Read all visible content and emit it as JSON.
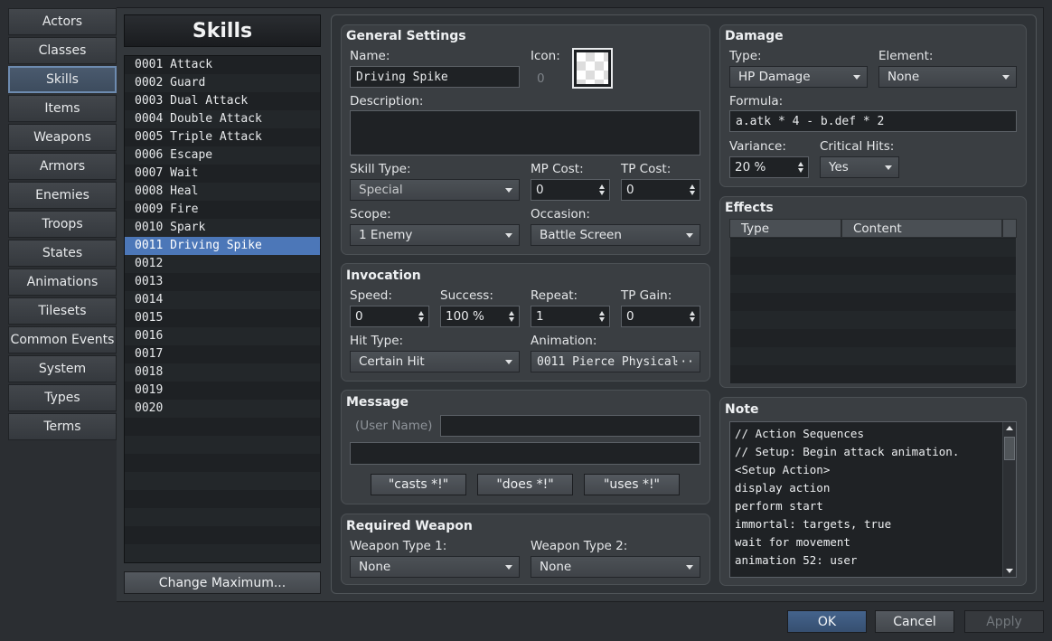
{
  "categories": [
    "Actors",
    "Classes",
    "Skills",
    "Items",
    "Weapons",
    "Armors",
    "Enemies",
    "Troops",
    "States",
    "Animations",
    "Tilesets",
    "Common Events",
    "System",
    "Types",
    "Terms"
  ],
  "active_category": "Skills",
  "skills_title": "Skills",
  "skill_list": [
    "0001 Attack",
    "0002 Guard",
    "0003 Dual Attack",
    "0004 Double Attack",
    "0005 Triple Attack",
    "0006 Escape",
    "0007 Wait",
    "0008 Heal",
    "0009 Fire",
    "0010 Spark",
    "0011 Driving Spike",
    "0012",
    "0013",
    "0014",
    "0015",
    "0016",
    "0017",
    "0018",
    "0019",
    "0020"
  ],
  "selected_index": 10,
  "change_max_label": "Change Maximum...",
  "general": {
    "title": "General Settings",
    "name_label": "Name:",
    "name_value": "Driving Spike",
    "icon_label": "Icon:",
    "icon_index": "0",
    "description_label": "Description:",
    "description_value": "",
    "skill_type_label": "Skill Type:",
    "skill_type_value": "Special",
    "mp_cost_label": "MP Cost:",
    "mp_cost_value": "0",
    "tp_cost_label": "TP Cost:",
    "tp_cost_value": "0",
    "scope_label": "Scope:",
    "scope_value": "1 Enemy",
    "occasion_label": "Occasion:",
    "occasion_value": "Battle Screen"
  },
  "invocation": {
    "title": "Invocation",
    "speed_label": "Speed:",
    "speed_value": "0",
    "success_label": "Success:",
    "success_value": "100 %",
    "repeat_label": "Repeat:",
    "repeat_value": "1",
    "tp_gain_label": "TP Gain:",
    "tp_gain_value": "0",
    "hit_type_label": "Hit Type:",
    "hit_type_value": "Certain Hit",
    "animation_label": "Animation:",
    "animation_value": "0011 Pierce Physical",
    "animation_more": "···"
  },
  "message": {
    "title": "Message",
    "user_name_placeholder": "(User Name)",
    "line1_value": "",
    "line2_value": "",
    "buttons": [
      "\"casts *!\"",
      "\"does *!\"",
      "\"uses *!\""
    ]
  },
  "required_weapon": {
    "title": "Required Weapon",
    "type1_label": "Weapon Type 1:",
    "type1_value": "None",
    "type2_label": "Weapon Type 2:",
    "type2_value": "None"
  },
  "damage": {
    "title": "Damage",
    "type_label": "Type:",
    "type_value": "HP Damage",
    "element_label": "Element:",
    "element_value": "None",
    "formula_label": "Formula:",
    "formula_value": "a.atk * 4 - b.def * 2",
    "variance_label": "Variance:",
    "variance_value": "20 %",
    "critical_label": "Critical Hits:",
    "critical_value": "Yes"
  },
  "effects": {
    "title": "Effects",
    "columns": [
      "Type",
      "Content"
    ],
    "rows": []
  },
  "note": {
    "title": "Note",
    "lines": [
      "// Action Sequences",
      "// Setup: Begin attack animation.",
      "<Setup Action>",
      "display action",
      "perform start",
      "immortal: targets, true",
      "wait for movement",
      "animation 52: user"
    ]
  },
  "footer": {
    "ok": "OK",
    "cancel": "Cancel",
    "apply": "Apply"
  },
  "colors": {
    "selection": "#4c77b8",
    "ok_button": "#3d5a80",
    "background": "#2b2e32"
  }
}
